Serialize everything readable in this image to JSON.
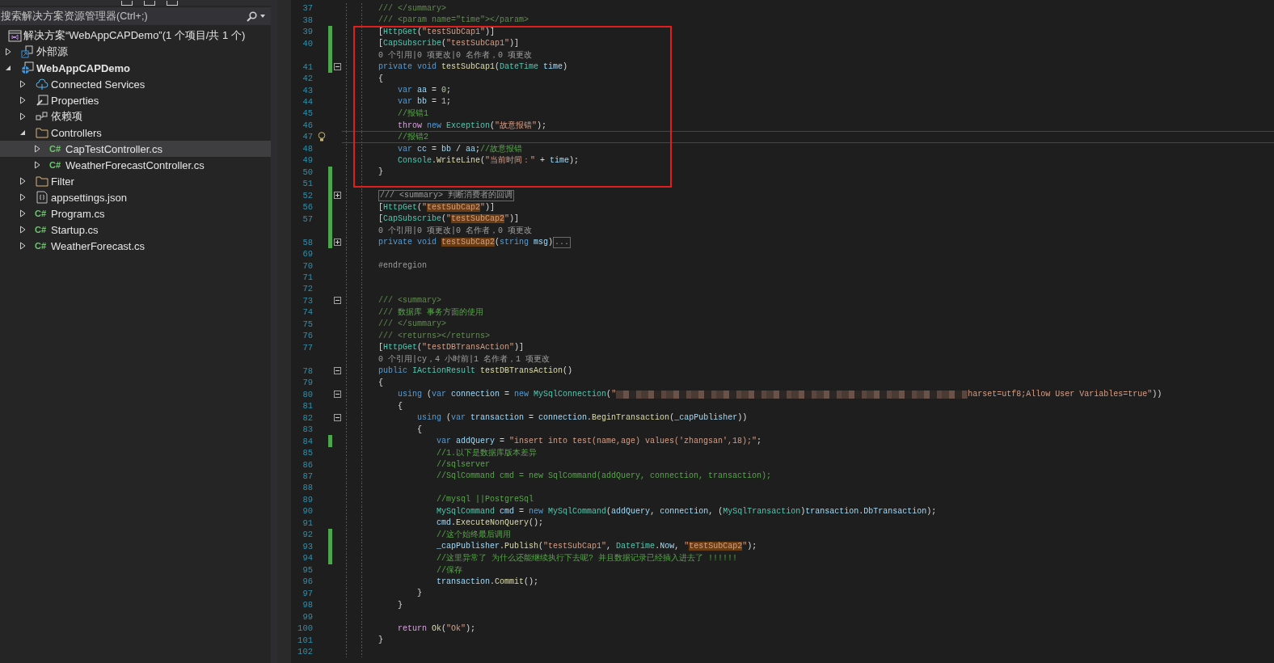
{
  "explorer": {
    "search": {
      "placeholder": "搜索解决方案资源管理器(Ctrl+;)"
    },
    "solution": {
      "label": "解决方案“WebAppCAPDemo”(1 个项目/共 1 个)"
    },
    "tree": [
      {
        "label": "外部源",
        "kind": "external",
        "expanded": false,
        "selected": false
      },
      {
        "label": "WebAppCAPDemo",
        "kind": "project",
        "expanded": true,
        "selected": false,
        "children": [
          {
            "label": "Connected Services",
            "kind": "cloud",
            "expanded": false,
            "selected": false
          },
          {
            "label": "Properties",
            "kind": "properties",
            "expanded": false,
            "selected": false
          },
          {
            "label": "依赖项",
            "kind": "dependencies",
            "expanded": false,
            "selected": false
          },
          {
            "label": "Controllers",
            "kind": "folder",
            "expanded": true,
            "selected": false,
            "children": [
              {
                "label": "CapTestController.cs",
                "kind": "csharp",
                "badge": "C#",
                "expanded": false,
                "selected": true
              },
              {
                "label": "WeatherForecastController.cs",
                "kind": "csharp",
                "badge": "C#",
                "expanded": false,
                "selected": false
              }
            ]
          },
          {
            "label": "Filter",
            "kind": "folder",
            "expanded": false,
            "selected": false
          },
          {
            "label": "appsettings.json",
            "kind": "json",
            "expanded": false,
            "selected": false
          },
          {
            "label": "Program.cs",
            "kind": "csharp",
            "badge": "C#",
            "expanded": false,
            "selected": false
          },
          {
            "label": "Startup.cs",
            "kind": "csharp",
            "badge": "C#",
            "expanded": false,
            "selected": false
          },
          {
            "label": "WeatherForecast.cs",
            "kind": "csharp",
            "badge": "C#",
            "expanded": false,
            "selected": false
          }
        ]
      }
    ]
  },
  "editor": {
    "annotation": {
      "kind": "rectangle"
    },
    "lines": [
      {
        "number": "37",
        "tokens": [
          {
            "kind": "doc",
            "text": "/// </summary>"
          }
        ]
      },
      {
        "number": "38",
        "tokens": [
          {
            "kind": "doc",
            "text": "/// <param name=\"time\"></param>"
          }
        ]
      },
      {
        "number": "39",
        "changed": true,
        "tokens": [
          {
            "kind": "plain",
            "text": "["
          },
          {
            "kind": "type",
            "text": "HttpGet"
          },
          {
            "kind": "plain",
            "text": "("
          },
          {
            "kind": "string",
            "text": "\"testSubCap1\""
          },
          {
            "kind": "plain",
            "text": ")]"
          }
        ]
      },
      {
        "number": "40",
        "changed": true,
        "tokens": [
          {
            "kind": "plain",
            "text": "["
          },
          {
            "kind": "type",
            "text": "CapSubscribe"
          },
          {
            "kind": "plain",
            "text": "("
          },
          {
            "kind": "string",
            "text": "\"testSubCap1\""
          },
          {
            "kind": "plain",
            "text": ")]"
          }
        ]
      },
      {
        "changed": true,
        "tokens": [
          {
            "kind": "lens",
            "text": "0 个引用|0 项更改|0 名作者，0 项更改"
          }
        ]
      },
      {
        "number": "41",
        "changed": true,
        "expanded": true,
        "tokens": [
          {
            "kind": "keyword",
            "text": "private void "
          },
          {
            "kind": "method",
            "text": "testSubCap1"
          },
          {
            "kind": "plain",
            "text": "("
          },
          {
            "kind": "type",
            "text": "DateTime"
          },
          {
            "kind": "var",
            "text": " time"
          },
          {
            "kind": "plain",
            "text": ")"
          }
        ]
      },
      {
        "number": "42",
        "tokens": [
          {
            "kind": "plain",
            "text": "{"
          }
        ]
      },
      {
        "number": "43",
        "tokens": [
          {
            "kind": "keyword",
            "text": "    var "
          },
          {
            "kind": "var",
            "text": "aa"
          },
          {
            "kind": "plain",
            "text": " = "
          },
          {
            "kind": "number",
            "text": "0"
          },
          {
            "kind": "plain",
            "text": ";"
          }
        ]
      },
      {
        "number": "44",
        "tokens": [
          {
            "kind": "keyword",
            "text": "    var "
          },
          {
            "kind": "var",
            "text": "bb"
          },
          {
            "kind": "plain",
            "text": " = "
          },
          {
            "kind": "number",
            "text": "1"
          },
          {
            "kind": "plain",
            "text": ";"
          }
        ]
      },
      {
        "number": "45",
        "tokens": [
          {
            "kind": "comment",
            "text": "    //报错1"
          }
        ]
      },
      {
        "number": "46",
        "tokens": [
          {
            "kind": "control",
            "text": "    throw "
          },
          {
            "kind": "keyword",
            "text": "new "
          },
          {
            "kind": "type",
            "text": "Exception"
          },
          {
            "kind": "plain",
            "text": "("
          },
          {
            "kind": "string",
            "text": "\"故意报错\""
          },
          {
            "kind": "plain",
            "text": ");"
          }
        ]
      },
      {
        "number": "47",
        "current": true,
        "bulb": true,
        "tokens": [
          {
            "kind": "comment",
            "text": "    //报错2"
          }
        ]
      },
      {
        "number": "48",
        "tokens": [
          {
            "kind": "keyword",
            "text": "    var "
          },
          {
            "kind": "var",
            "text": "cc"
          },
          {
            "kind": "plain",
            "text": " = "
          },
          {
            "kind": "var",
            "text": "bb"
          },
          {
            "kind": "plain",
            "text": " / "
          },
          {
            "kind": "var",
            "text": "aa"
          },
          {
            "kind": "plain",
            "text": ";"
          },
          {
            "kind": "comment",
            "text": "//故意报错"
          }
        ]
      },
      {
        "number": "49",
        "tokens": [
          {
            "kind": "type",
            "text": "    Console"
          },
          {
            "kind": "plain",
            "text": "."
          },
          {
            "kind": "method",
            "text": "WriteLine"
          },
          {
            "kind": "plain",
            "text": "("
          },
          {
            "kind": "string",
            "text": "\"当前时间：\""
          },
          {
            "kind": "plain",
            "text": " + "
          },
          {
            "kind": "var",
            "text": "time"
          },
          {
            "kind": "plain",
            "text": ");"
          }
        ]
      },
      {
        "number": "50",
        "changed": true,
        "tokens": [
          {
            "kind": "plain",
            "text": "}"
          }
        ]
      },
      {
        "number": "51",
        "changed": true
      },
      {
        "number": "52",
        "changed": true,
        "expanded": false,
        "tokens": [
          {
            "kind": "outlined",
            "text": "/// <summary> 判断消费者的回调"
          }
        ]
      },
      {
        "number": "56",
        "changed": true,
        "tokens": [
          {
            "kind": "plain",
            "text": "["
          },
          {
            "kind": "type",
            "text": "HttpGet"
          },
          {
            "kind": "plain",
            "text": "("
          },
          {
            "kind": "string",
            "text": "\""
          },
          {
            "kind": "match",
            "text": "testSubCap2"
          },
          {
            "kind": "string",
            "text": "\""
          },
          {
            "kind": "plain",
            "text": ")]"
          }
        ]
      },
      {
        "number": "57",
        "changed": true,
        "tokens": [
          {
            "kind": "plain",
            "text": "["
          },
          {
            "kind": "type",
            "text": "CapSubscribe"
          },
          {
            "kind": "plain",
            "text": "("
          },
          {
            "kind": "string",
            "text": "\""
          },
          {
            "kind": "match",
            "text": "testSubCap2"
          },
          {
            "kind": "string",
            "text": "\""
          },
          {
            "kind": "plain",
            "text": ")]"
          }
        ]
      },
      {
        "changed": true,
        "tokens": [
          {
            "kind": "lens",
            "text": "0 个引用|0 项更改|0 名作者，0 项更改"
          }
        ]
      },
      {
        "number": "58",
        "changed": true,
        "expanded": false,
        "tokens": [
          {
            "kind": "keyword",
            "text": "private void "
          },
          {
            "kind": "match",
            "text": "testSubCap2"
          },
          {
            "kind": "plain",
            "text": "("
          },
          {
            "kind": "keyword",
            "text": "string "
          },
          {
            "kind": "var",
            "text": "msg"
          },
          {
            "kind": "plain",
            "text": ")"
          },
          {
            "kind": "outlined",
            "text": "..."
          }
        ]
      },
      {
        "number": "69"
      },
      {
        "number": "70",
        "tokens": [
          {
            "kind": "directive",
            "text": "#endregion"
          }
        ]
      },
      {
        "number": "71"
      },
      {
        "number": "72"
      },
      {
        "number": "73",
        "expanded": true,
        "tokens": [
          {
            "kind": "doc",
            "text": "/// <summary>"
          }
        ]
      },
      {
        "number": "74",
        "tokens": [
          {
            "kind": "doc",
            "text": "/// "
          },
          {
            "kind": "comment",
            "text": "数据库 事务方面的使用"
          }
        ]
      },
      {
        "number": "75",
        "tokens": [
          {
            "kind": "doc",
            "text": "/// </summary>"
          }
        ]
      },
      {
        "number": "76",
        "tokens": [
          {
            "kind": "doc",
            "text": "/// <returns></returns>"
          }
        ]
      },
      {
        "number": "77",
        "tokens": [
          {
            "kind": "plain",
            "text": "["
          },
          {
            "kind": "type",
            "text": "HttpGet"
          },
          {
            "kind": "plain",
            "text": "("
          },
          {
            "kind": "string",
            "text": "\"testDBTransAction\""
          },
          {
            "kind": "plain",
            "text": ")]"
          }
        ]
      },
      {
        "tokens": [
          {
            "kind": "lens",
            "text": "0 个引用|cy，4 小时前|1 名作者，1 项更改"
          }
        ]
      },
      {
        "number": "78",
        "expanded": true,
        "tokens": [
          {
            "kind": "keyword",
            "text": "public "
          },
          {
            "kind": "type",
            "text": "IActionResult "
          },
          {
            "kind": "method",
            "text": "testDBTransAction"
          },
          {
            "kind": "plain",
            "text": "()"
          }
        ]
      },
      {
        "number": "79",
        "tokens": [
          {
            "kind": "plain",
            "text": "{"
          }
        ]
      },
      {
        "number": "80",
        "expanded": true,
        "tokens": [
          {
            "kind": "keyword",
            "text": "    using "
          },
          {
            "kind": "plain",
            "text": "("
          },
          {
            "kind": "keyword",
            "text": "var "
          },
          {
            "kind": "var",
            "text": "connection"
          },
          {
            "kind": "plain",
            "text": " = "
          },
          {
            "kind": "keyword",
            "text": "new "
          },
          {
            "kind": "type",
            "text": "MySqlConnection"
          },
          {
            "kind": "plain",
            "text": "("
          },
          {
            "kind": "string",
            "text": "\""
          },
          {
            "kind": "redacted"
          },
          {
            "kind": "string",
            "text": "harset=utf8;Allow User Variables=true\""
          },
          {
            "kind": "plain",
            "text": "))"
          }
        ]
      },
      {
        "number": "81",
        "tokens": [
          {
            "kind": "plain",
            "text": "    {"
          }
        ]
      },
      {
        "number": "82",
        "expanded": true,
        "tokens": [
          {
            "kind": "keyword",
            "text": "        using "
          },
          {
            "kind": "plain",
            "text": "("
          },
          {
            "kind": "keyword",
            "text": "var "
          },
          {
            "kind": "var",
            "text": "transaction"
          },
          {
            "kind": "plain",
            "text": " = "
          },
          {
            "kind": "var",
            "text": "connection"
          },
          {
            "kind": "plain",
            "text": "."
          },
          {
            "kind": "method",
            "text": "BeginTransaction"
          },
          {
            "kind": "plain",
            "text": "("
          },
          {
            "kind": "var",
            "text": "_capPublisher"
          },
          {
            "kind": "plain",
            "text": "))"
          }
        ]
      },
      {
        "number": "83",
        "tokens": [
          {
            "kind": "plain",
            "text": "        {"
          }
        ]
      },
      {
        "number": "84",
        "changed": true,
        "tokens": [
          {
            "kind": "keyword",
            "text": "            var "
          },
          {
            "kind": "var",
            "text": "addQuery"
          },
          {
            "kind": "plain",
            "text": " = "
          },
          {
            "kind": "string",
            "text": "\"insert into test(name,age) values('zhangsan',18);\""
          },
          {
            "kind": "plain",
            "text": ";"
          }
        ]
      },
      {
        "number": "85",
        "tokens": [
          {
            "kind": "comment",
            "text": "            //1.以下是数据库版本差异"
          }
        ]
      },
      {
        "number": "86",
        "tokens": [
          {
            "kind": "comment",
            "text": "            //sqlserver"
          }
        ]
      },
      {
        "number": "87",
        "tokens": [
          {
            "kind": "comment",
            "text": "            //SqlCommand cmd = new SqlCommand(addQuery, connection, transaction);"
          }
        ]
      },
      {
        "number": "88"
      },
      {
        "number": "89",
        "tokens": [
          {
            "kind": "comment",
            "text": "            //mysql ||PostgreSql"
          }
        ]
      },
      {
        "number": "90",
        "tokens": [
          {
            "kind": "type",
            "text": "            MySqlCommand "
          },
          {
            "kind": "var",
            "text": "cmd"
          },
          {
            "kind": "plain",
            "text": " = "
          },
          {
            "kind": "keyword",
            "text": "new "
          },
          {
            "kind": "type",
            "text": "MySqlCommand"
          },
          {
            "kind": "plain",
            "text": "("
          },
          {
            "kind": "var",
            "text": "addQuery"
          },
          {
            "kind": "plain",
            "text": ", "
          },
          {
            "kind": "var",
            "text": "connection"
          },
          {
            "kind": "plain",
            "text": ", ("
          },
          {
            "kind": "type",
            "text": "MySqlTransaction"
          },
          {
            "kind": "plain",
            "text": ")"
          },
          {
            "kind": "var",
            "text": "transaction"
          },
          {
            "kind": "plain",
            "text": "."
          },
          {
            "kind": "var",
            "text": "DbTransaction"
          },
          {
            "kind": "plain",
            "text": ");"
          }
        ]
      },
      {
        "number": "91",
        "tokens": [
          {
            "kind": "var",
            "text": "            cmd"
          },
          {
            "kind": "plain",
            "text": "."
          },
          {
            "kind": "method",
            "text": "ExecuteNonQuery"
          },
          {
            "kind": "plain",
            "text": "();"
          }
        ]
      },
      {
        "number": "92",
        "changed": true,
        "tokens": [
          {
            "kind": "comment",
            "text": "            //这个始终最后调用"
          }
        ]
      },
      {
        "number": "93",
        "changed": true,
        "tokens": [
          {
            "kind": "var",
            "text": "            _capPublisher"
          },
          {
            "kind": "plain",
            "text": "."
          },
          {
            "kind": "method",
            "text": "Publish"
          },
          {
            "kind": "plain",
            "text": "("
          },
          {
            "kind": "string",
            "text": "\"testSubCap1\""
          },
          {
            "kind": "plain",
            "text": ", "
          },
          {
            "kind": "type",
            "text": "DateTime"
          },
          {
            "kind": "plain",
            "text": "."
          },
          {
            "kind": "var",
            "text": "Now"
          },
          {
            "kind": "plain",
            "text": ", "
          },
          {
            "kind": "string",
            "text": "\""
          },
          {
            "kind": "match",
            "text": "testSubCap2"
          },
          {
            "kind": "string",
            "text": "\""
          },
          {
            "kind": "plain",
            "text": ");"
          }
        ]
      },
      {
        "number": "94",
        "changed": true,
        "tokens": [
          {
            "kind": "comment",
            "text": "            //这里异常了 为什么还能继续执行下去呢? 并且数据记录已经插入进去了 !!!!!!"
          }
        ]
      },
      {
        "number": "95",
        "tokens": [
          {
            "kind": "comment",
            "text": "            //保存"
          }
        ]
      },
      {
        "number": "96",
        "tokens": [
          {
            "kind": "var",
            "text": "            transaction"
          },
          {
            "kind": "plain",
            "text": "."
          },
          {
            "kind": "method",
            "text": "Commit"
          },
          {
            "kind": "plain",
            "text": "();"
          }
        ]
      },
      {
        "number": "97",
        "tokens": [
          {
            "kind": "plain",
            "text": "        }"
          }
        ]
      },
      {
        "number": "98",
        "tokens": [
          {
            "kind": "plain",
            "text": "    }"
          }
        ]
      },
      {
        "number": "99"
      },
      {
        "number": "100",
        "tokens": [
          {
            "kind": "control",
            "text": "    return "
          },
          {
            "kind": "method",
            "text": "Ok"
          },
          {
            "kind": "plain",
            "text": "("
          },
          {
            "kind": "string",
            "text": "\"Ok\""
          },
          {
            "kind": "plain",
            "text": ");"
          }
        ]
      },
      {
        "number": "101",
        "tokens": [
          {
            "kind": "plain",
            "text": "}"
          }
        ]
      },
      {
        "number": "102"
      }
    ]
  }
}
